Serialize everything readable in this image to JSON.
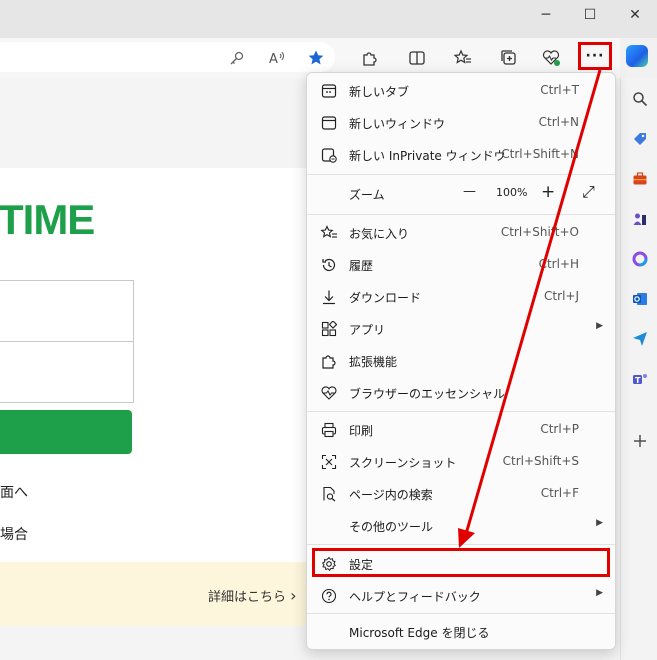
{
  "window": {
    "minimize": "─",
    "maximize": "☐",
    "close": "✕"
  },
  "toolbar": {
    "more_label": "···"
  },
  "page": {
    "logo_text": "TIME",
    "link1": "面へ",
    "link2": "場合",
    "banner_link": "詳細はこちら",
    "banner_chevron": "›"
  },
  "menu": {
    "new_tab": {
      "label": "新しいタブ",
      "shortcut": "Ctrl+T"
    },
    "new_window": {
      "label": "新しいウィンドウ",
      "shortcut": "Ctrl+N"
    },
    "new_inprivate": {
      "label": "新しい InPrivate ウィンドウ",
      "shortcut": "Ctrl+Shift+N"
    },
    "zoom": {
      "label": "ズーム",
      "minus": "—",
      "value": "100%",
      "plus": "+",
      "fullscreen": "⤢"
    },
    "favorites": {
      "label": "お気に入り",
      "shortcut": "Ctrl+Shift+O"
    },
    "history": {
      "label": "履歴",
      "shortcut": "Ctrl+H"
    },
    "downloads": {
      "label": "ダウンロード",
      "shortcut": "Ctrl+J"
    },
    "apps": {
      "label": "アプリ",
      "arrow": "▶"
    },
    "extensions": {
      "label": "拡張機能"
    },
    "essentials": {
      "label": "ブラウザーのエッセンシャル"
    },
    "print": {
      "label": "印刷",
      "shortcut": "Ctrl+P"
    },
    "screenshot": {
      "label": "スクリーンショット",
      "shortcut": "Ctrl+Shift+S"
    },
    "find": {
      "label": "ページ内の検索",
      "shortcut": "Ctrl+F"
    },
    "more_tools": {
      "label": "その他のツール",
      "arrow": "▶"
    },
    "settings": {
      "label": "設定"
    },
    "help": {
      "label": "ヘルプとフィードバック",
      "arrow": "▶"
    },
    "close_edge": {
      "label": "Microsoft Edge を閉じる"
    }
  },
  "colors": {
    "highlight": "#e00000",
    "brand_green": "#1e9f4a",
    "star": "#1a66d2"
  }
}
